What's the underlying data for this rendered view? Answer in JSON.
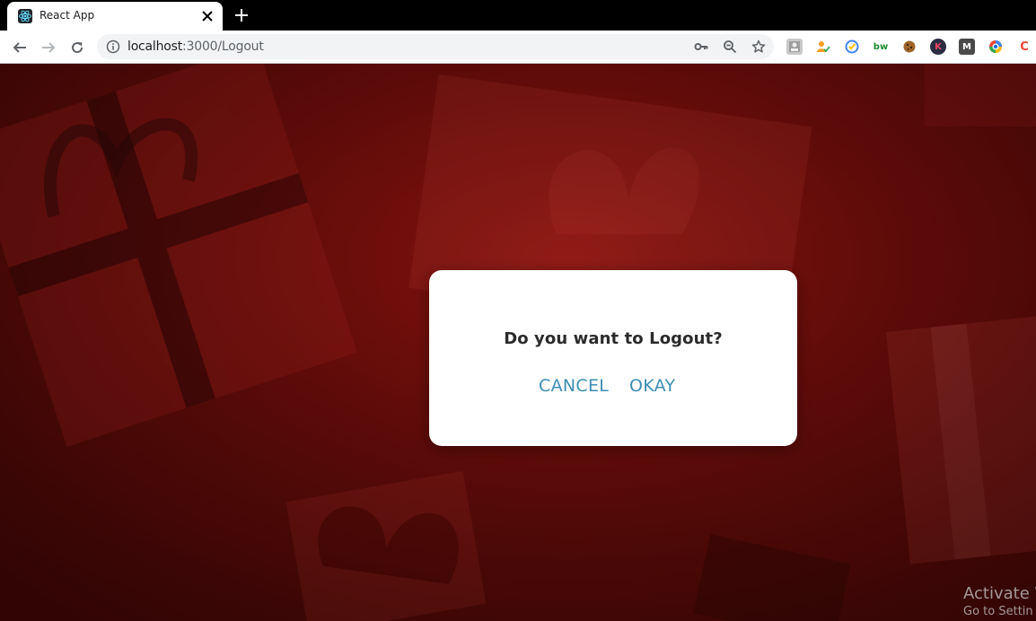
{
  "browser": {
    "tab": {
      "title": "React App",
      "favicon": "react-logo-icon"
    },
    "new_tab_icon": "plus-icon",
    "url": {
      "host": "localhost",
      "rest": ":3000/Logout"
    },
    "extensions": [
      {
        "name": "extension-1-icon",
        "label": ""
      },
      {
        "name": "extension-2-icon",
        "label": ""
      },
      {
        "name": "extension-3-icon",
        "label": ""
      },
      {
        "name": "extension-bw-icon",
        "label": "bw"
      },
      {
        "name": "extension-cookie-icon",
        "label": ""
      },
      {
        "name": "extension-k-icon",
        "label": "K"
      },
      {
        "name": "extension-m-icon",
        "label": "M"
      },
      {
        "name": "extension-color-icon",
        "label": ""
      },
      {
        "name": "extension-c-icon",
        "label": "C"
      }
    ]
  },
  "dialog": {
    "title": "Do you want to Logout?",
    "cancel_label": "CANCEL",
    "okay_label": "OKAY"
  },
  "watermark": {
    "title": "Activate W",
    "subtitle": "Go to Settin"
  },
  "colors": {
    "background": "#7a100c",
    "dialog_button": "#3d8eb3"
  }
}
